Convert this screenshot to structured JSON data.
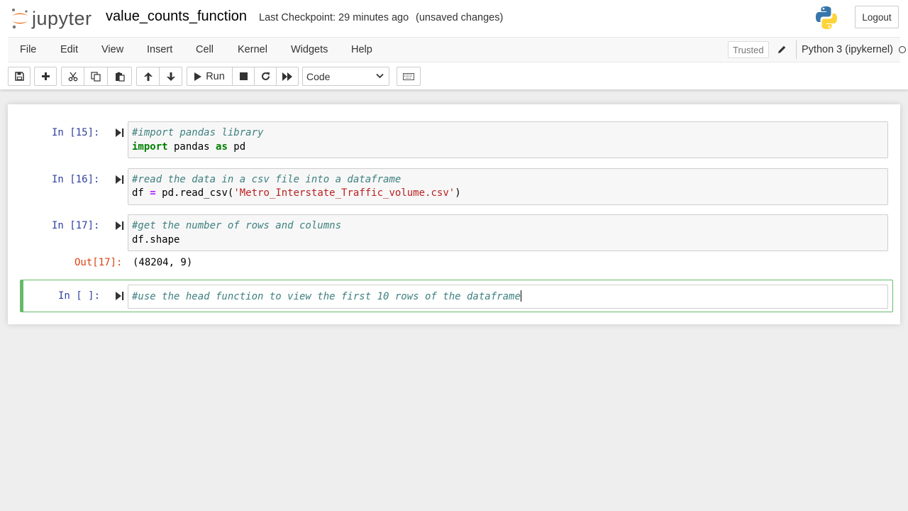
{
  "app": {
    "logo_text": "jupyter",
    "notebook_name": "value_counts_function",
    "checkpoint": "Last Checkpoint: 29 minutes ago",
    "unsaved": "(unsaved changes)",
    "logout_label": "Logout"
  },
  "menubar": {
    "items": [
      "File",
      "Edit",
      "View",
      "Insert",
      "Cell",
      "Kernel",
      "Widgets",
      "Help"
    ],
    "trusted_label": "Trusted",
    "kernel_name": "Python 3 (ipykernel)"
  },
  "toolbar": {
    "run_label": "Run",
    "cell_type": "Code",
    "icons": [
      "save-icon",
      "plus-icon",
      "cut-icon",
      "copy-icon",
      "paste-icon",
      "arrow-up-icon",
      "arrow-down-icon",
      "run-icon",
      "stop-icon",
      "restart-icon",
      "fast-forward-icon",
      "chevron-down-icon",
      "keyboard-icon"
    ]
  },
  "cells": [
    {
      "prompt": "In [15]:",
      "lines": [
        {
          "comment": "#import pandas library"
        },
        {
          "kw1": "import",
          "mid": " pandas ",
          "kw2": "as",
          "tail": " pd"
        }
      ]
    },
    {
      "prompt": "In [16]:",
      "lines": [
        {
          "comment": "#read the data in a csv file into a dataframe"
        },
        {
          "pre": "df ",
          "op": "=",
          "mid": " pd.read_csv(",
          "str": "'Metro_Interstate_Traffic_volume.csv'",
          "tail": ")"
        }
      ]
    },
    {
      "prompt": "In [17]:",
      "lines": [
        {
          "comment": "#get the number of rows and columns"
        },
        {
          "text": "df.shape"
        }
      ],
      "out_prompt": "Out[17]:",
      "output": "(48204, 9)"
    },
    {
      "prompt": "In [ ]:",
      "lines": [
        {
          "comment": "#use the head function to view the first 10 rows of the dataframe"
        }
      ]
    }
  ],
  "colors": {
    "in_prompt": "#303f9f",
    "out_prompt": "#d84315",
    "selected_border": "#66bb6a",
    "comment": "#408080",
    "keyword": "#008000",
    "string": "#ba2121"
  }
}
